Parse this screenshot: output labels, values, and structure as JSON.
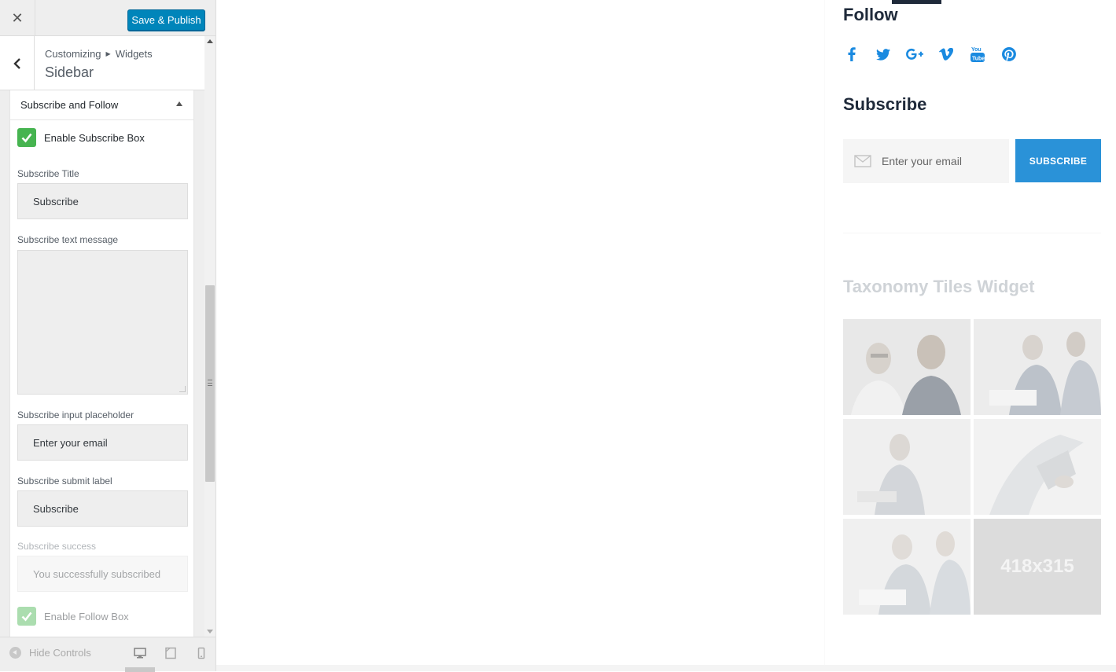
{
  "header": {
    "close_label": "✕",
    "save_label": "Save & Publish"
  },
  "section": {
    "breadcrumb_root": "Customizing",
    "breadcrumb_child": "Widgets",
    "title": "Sidebar"
  },
  "widget": {
    "title": "Subscribe and Follow",
    "enable_subscribe_label": "Enable Subscribe Box",
    "enable_subscribe_checked": true,
    "subscribe_title_label": "Subscribe Title",
    "subscribe_title_value": "Subscribe",
    "subscribe_text_label": "Subscribe text message",
    "subscribe_text_value": "",
    "placeholder_label": "Subscribe input placeholder",
    "placeholder_value": "Enter your email",
    "submit_label_label": "Subscribe submit label",
    "submit_label_value": "Subscribe",
    "success_label": "Subscribe success",
    "success_value": "You successfully subscribed",
    "enable_follow_label": "Enable Follow Box",
    "enable_follow_checked": true
  },
  "footer": {
    "hide_controls": "Hide Controls",
    "devices": [
      "desktop-icon",
      "tablet-icon",
      "mobile-icon"
    ]
  },
  "preview": {
    "follow_title": "Follow",
    "social_icons": [
      "facebook-icon",
      "twitter-icon",
      "google-plus-icon",
      "vimeo-icon",
      "youtube-icon",
      "pinterest-icon"
    ],
    "subscribe_title": "Subscribe",
    "subscribe_placeholder": "Enter your email",
    "subscribe_button": "SUBSCRIBE",
    "taxonomy_title": "Taxonomy Tiles Widget",
    "tile_placeholder": "418x315"
  },
  "colors": {
    "primary_button": "#0085ba",
    "checkbox_green": "#46b450",
    "accent_blue": "#2a92d8",
    "heading_dark": "#1f2a3a"
  }
}
